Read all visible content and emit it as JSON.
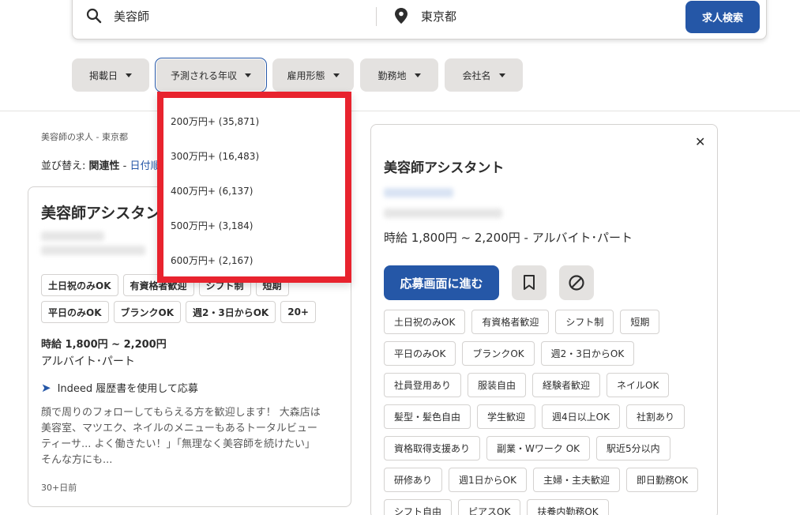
{
  "search": {
    "what_value": "美容師",
    "where_value": "東京都",
    "button_label": "求人検索"
  },
  "filters": [
    {
      "label": "掲載日"
    },
    {
      "label": "予測される年収"
    },
    {
      "label": "雇用形態"
    },
    {
      "label": "勤務地"
    },
    {
      "label": "会社名"
    }
  ],
  "dropdown": {
    "items": [
      "200万円+ (35,871)",
      "300万円+ (16,483)",
      "400万円+ (6,137)",
      "500万円+ (3,184)",
      "600万円+ (2,167)"
    ]
  },
  "results": {
    "breadcrumb": "美容師の求人 - 東京都",
    "sort_prefix": "並び替え: ",
    "sort_active": "関連性",
    "sort_separator": " - ",
    "sort_other": "日付順"
  },
  "job_card": {
    "title": "美容師アシスタント",
    "tags": [
      "土日祝のみOK",
      "有資格者歓迎",
      "シフト制",
      "短期",
      "平日のみOK",
      "ブランクOK",
      "週2・3日からOK",
      "20+"
    ],
    "salary": "時給 1,800円 ~ 2,200円",
    "job_type": "アルバイト･パート",
    "apply_text": "Indeed 履歴書を使用して応募",
    "snippet": "顔で周りのフォローしてもらえる方を歓迎します！ 大森店は美容室、マツエク、ネイルのメニューもあるトータルビューティーサ... よく働きたい！」「無理なく美容師を続けたい」 そんな方にも...",
    "posted": "30+日前"
  },
  "panel": {
    "title": "美容師アシスタント",
    "salary_type": "時給 1,800円 ~ 2,200円  - アルバイト･パート",
    "apply_button": "応募画面に進む",
    "tags": [
      "土日祝のみOK",
      "有資格者歓迎",
      "シフト制",
      "短期",
      "平日のみOK",
      "ブランクOK",
      "週2・3日からOK",
      "社員登用あり",
      "服装自由",
      "経験者歓迎",
      "ネイルOK",
      "髪型・髪色自由",
      "学生歓迎",
      "週4日以上OK",
      "社割あり",
      "資格取得支援あり",
      "副業・Wワーク OK",
      "駅近5分以内",
      "研修あり",
      "週1日からOK",
      "主婦・主夫歓迎",
      "即日勤務OK",
      "シフト自由",
      "ピアスOK",
      "扶養内勤務OK"
    ]
  },
  "colors": {
    "primary": "#2557a7",
    "highlight": "#e8232e",
    "chip_bg": "#e4e2e0"
  }
}
